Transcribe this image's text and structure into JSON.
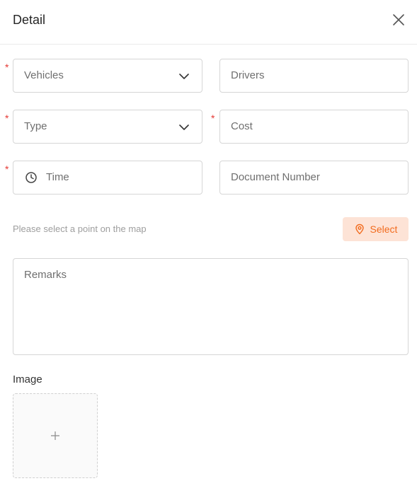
{
  "header": {
    "title": "Detail"
  },
  "form": {
    "vehicles_placeholder": "Vehicles",
    "drivers_placeholder": "Drivers",
    "type_placeholder": "Type",
    "cost_placeholder": "Cost",
    "time_placeholder": "Time",
    "document_number_placeholder": "Document Number",
    "required_mark": "*"
  },
  "location": {
    "hint": "Please select a point on the map",
    "select_label": "Select"
  },
  "remarks": {
    "placeholder": "Remarks"
  },
  "image": {
    "label": "Image"
  },
  "colors": {
    "required": "#e53935",
    "accent": "#f26b1d",
    "accent_bg": "#fde3d6",
    "border": "#d6d6d6"
  },
  "icons": {
    "close": "close-icon",
    "chevron": "chevron-down-icon",
    "clock": "clock-icon",
    "pin": "map-pin-icon",
    "plus": "plus-icon"
  }
}
